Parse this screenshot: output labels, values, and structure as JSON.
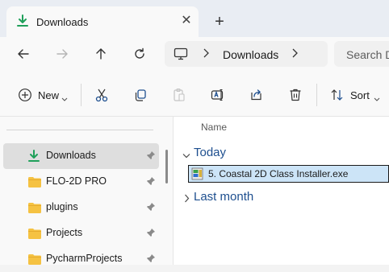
{
  "tab": {
    "title": "Downloads",
    "close_glyph": "✕",
    "new_tab_glyph": "+"
  },
  "navigation": {
    "back_icon": "arrow-left-icon",
    "forward_icon": "arrow-right-icon",
    "up_icon": "arrow-up-icon",
    "refresh_icon": "refresh-icon",
    "address": {
      "location": "Downloads"
    },
    "search_placeholder": "Search D"
  },
  "command_bar": {
    "new_label": "New",
    "sort_label": "Sort",
    "icons": [
      "cut-icon",
      "copy-icon",
      "paste-icon",
      "rename-icon",
      "share-icon",
      "delete-icon"
    ]
  },
  "sidebar": {
    "items": [
      {
        "label": "Downloads",
        "icon": "download-icon",
        "selected": true,
        "pinned": true
      },
      {
        "label": "FLO-2D PRO",
        "icon": "folder-icon",
        "pinned": true
      },
      {
        "label": "plugins",
        "icon": "folder-icon",
        "pinned": true
      },
      {
        "label": "Projects",
        "icon": "folder-icon",
        "pinned": true
      },
      {
        "label": "PycharmProjects",
        "icon": "folder-icon",
        "pinned": true
      }
    ]
  },
  "content": {
    "column_header": "Name",
    "groups": [
      {
        "label": "Today",
        "expanded": true,
        "files": [
          {
            "name": "5. Coastal 2D Class Installer.exe",
            "selected": true
          }
        ]
      },
      {
        "label": "Last month",
        "expanded": false,
        "files": []
      }
    ]
  },
  "colors": {
    "accent": "#1e4f8f",
    "selection": "#cce4f7",
    "download_green": "#1fa05a",
    "folder": "#f5c242"
  }
}
